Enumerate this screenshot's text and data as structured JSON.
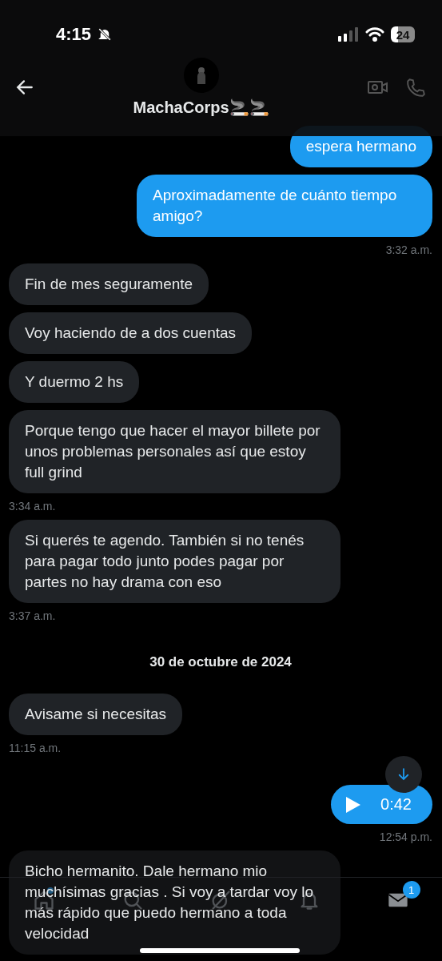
{
  "status_bar": {
    "time": "4:15",
    "battery": "24"
  },
  "header": {
    "name": "MachaCorps🚬🚬"
  },
  "messages": [
    {
      "kind": "outgoing",
      "text": "espera hermano"
    },
    {
      "kind": "outgoing",
      "text": "Aproximadamente de cuánto tiempo amigo?",
      "time": "3:32 a.m."
    },
    {
      "kind": "incoming",
      "text": "Fin de mes seguramente"
    },
    {
      "kind": "incoming",
      "text": "Voy haciendo de a dos cuentas"
    },
    {
      "kind": "incoming",
      "text": "Y duermo 2 hs"
    },
    {
      "kind": "incoming",
      "text": "Porque tengo que hacer el mayor billete por unos problemas personales así que estoy full grind",
      "time": "3:34 a.m."
    },
    {
      "kind": "incoming",
      "text": "Si querés te agendo. También si no tenés para pagar todo junto podes pagar por partes no hay drama con eso",
      "time": "3:37 a.m."
    },
    {
      "kind": "date",
      "text": "30 de octubre de 2024"
    },
    {
      "kind": "incoming",
      "text": "Avisame si necesitas",
      "time": "11:15 a.m."
    },
    {
      "kind": "voice",
      "text": "0:42",
      "time": "12:54 p.m."
    },
    {
      "kind": "incoming",
      "text": "Bicho hermanito. Dale hermano mio muchísimas gracias . Si voy a tardar voy lo más rápido que puedo hermano a toda velocidad"
    }
  ],
  "nav": [
    {
      "dot": true
    },
    {
      "dot": false
    },
    {
      "dot": false
    },
    {
      "dot": false
    },
    {
      "badge": "1",
      "dot": false
    }
  ]
}
